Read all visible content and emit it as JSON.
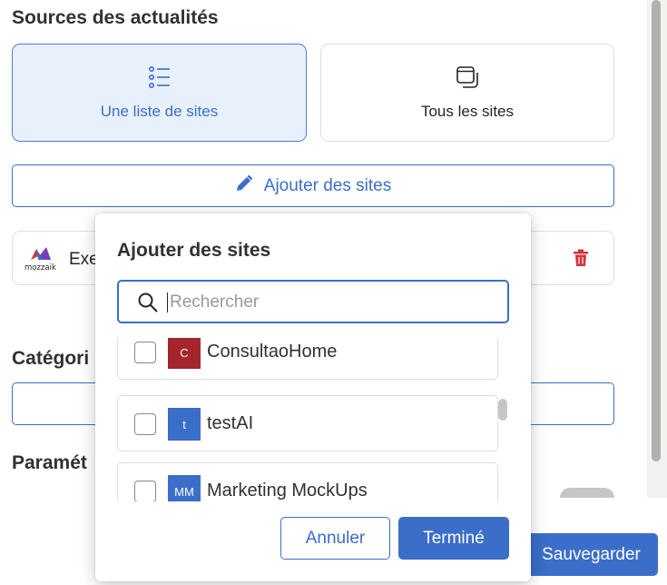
{
  "section_title": "Sources des actualités",
  "source_options": [
    {
      "label": "Une liste de sites",
      "icon": "bullet-list-icon",
      "selected": true
    },
    {
      "label": "Tous les sites",
      "icon": "windows-stack-icon",
      "selected": false
    }
  ],
  "add_sites_label": "Ajouter des sites",
  "selected_site": {
    "name": "Exe",
    "logo_text": "mozzaik"
  },
  "categories_label": "Catégori",
  "parameters_label": "Paramét",
  "save_label": "Sauvegarder",
  "popup": {
    "title": "Ajouter des sites",
    "search_placeholder": "Rechercher",
    "search_value": "",
    "items": [
      {
        "initials": "C",
        "name": "ConsultaoHome",
        "color": "#a4262c",
        "checked": false
      },
      {
        "initials": "t",
        "name": "testAI",
        "color": "#3b6ec9",
        "checked": false
      },
      {
        "initials": "MM",
        "name": "Marketing MockUps",
        "color": "#3b6ec9",
        "checked": false
      }
    ],
    "cancel_label": "Annuler",
    "done_label": "Terminé"
  },
  "colors": {
    "accent": "#3b6ec9",
    "danger": "#d13438",
    "selected_bg": "#e8f0fb"
  }
}
